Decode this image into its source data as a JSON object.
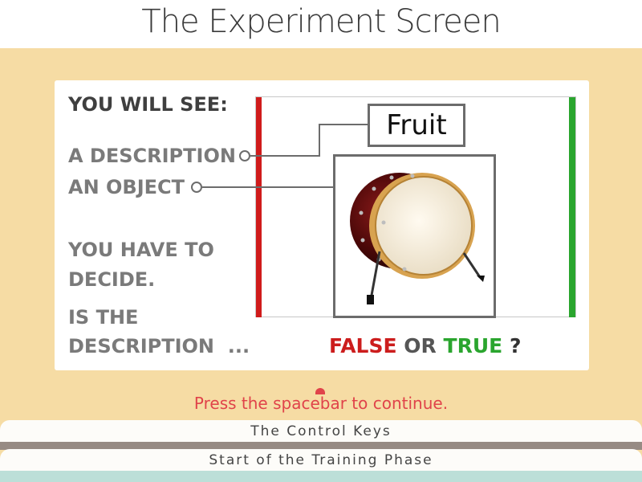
{
  "header": {
    "title": "The Experiment Screen"
  },
  "instructions": {
    "you_will_see": "YOU WILL SEE:",
    "a_description": "A DESCRIPTION",
    "an_object": "AN OBJECT",
    "you_have_to": "YOU HAVE TO",
    "decide": "DECIDE.",
    "is_the": "IS THE",
    "description_dots": "DESCRIPTION  ..."
  },
  "stage": {
    "description_word": "Fruit",
    "object_icon": "bass-drum-icon"
  },
  "answer": {
    "false_label": "FALSE",
    "or_label": "OR",
    "true_label": "TRUE",
    "question_mark": "?"
  },
  "footer": {
    "continue_msg": "Press the spacebar to continue.",
    "tab_control_keys": "The Control Keys",
    "tab_training": "Start of the Training Phase"
  },
  "colors": {
    "false": "#cc1d1d",
    "true": "#2aa52e",
    "background": "#f6dca4",
    "continue": "#e0434a"
  }
}
